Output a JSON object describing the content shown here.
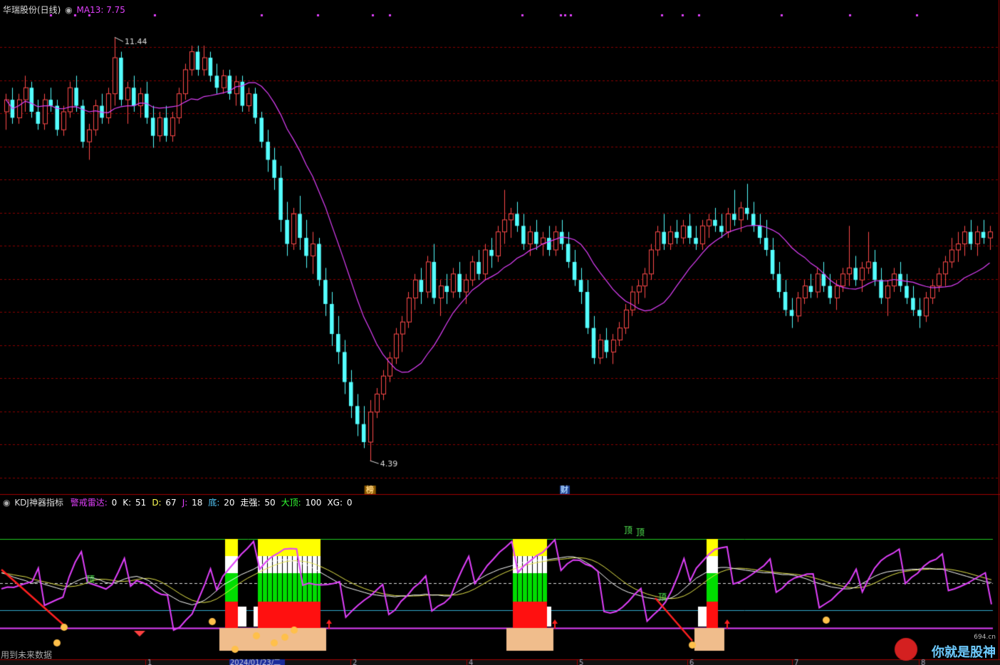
{
  "main_header": {
    "stock": "华瑞股份(日线)",
    "ma_label": "MA13: 7.75"
  },
  "high_label": "11.44",
  "low_label": "4.39",
  "event_marks": [
    "榜",
    "财"
  ],
  "ind_header": {
    "name": "KDJ神器指标",
    "items": [
      {
        "label": "警戒雷达:",
        "value": "0",
        "color": "#e040fb"
      },
      {
        "label": "K:",
        "value": "51",
        "color": "#ffffff"
      },
      {
        "label": "D:",
        "value": "67",
        "color": "#ffff55"
      },
      {
        "label": "J:",
        "value": "18",
        "color": "#e040fb"
      },
      {
        "label": "底:",
        "value": "20",
        "color": "#55ccff"
      },
      {
        "label": "走强:",
        "value": "50",
        "color": "#ffffff"
      },
      {
        "label": "大顶:",
        "value": "100",
        "color": "#33ff33"
      },
      {
        "label": "XG:",
        "value": "0",
        "color": "#ffffff"
      }
    ]
  },
  "annotations": [
    "顶",
    "顶",
    "顶",
    "顶"
  ],
  "future_note": "用到未来数据",
  "date_label": "2024/01/23/二",
  "watermark": {
    "text": "你就是股神",
    "site": "694.cn"
  },
  "colors": {
    "up": "#ff4a4a",
    "down": "#54ffff",
    "ma": "#e040fb",
    "grid": "#8b0000"
  },
  "chart_data": {
    "type": "candlestick",
    "price_range": [
      4.39,
      11.44
    ],
    "ma_period": 13,
    "candles_ohlc": [
      [
        10.2,
        10.5,
        9.9,
        10.4
      ],
      [
        10.4,
        10.6,
        10.0,
        10.1
      ],
      [
        10.1,
        10.5,
        10.0,
        10.4
      ],
      [
        10.4,
        10.8,
        10.2,
        10.6
      ],
      [
        10.6,
        10.7,
        10.1,
        10.2
      ],
      [
        10.2,
        10.4,
        9.9,
        10.0
      ],
      [
        10.0,
        10.5,
        9.9,
        10.4
      ],
      [
        10.4,
        10.6,
        10.2,
        10.3
      ],
      [
        10.3,
        10.4,
        9.8,
        9.9
      ],
      [
        9.9,
        10.3,
        9.8,
        10.2
      ],
      [
        10.2,
        10.7,
        10.1,
        10.6
      ],
      [
        10.6,
        10.8,
        10.2,
        10.3
      ],
      [
        10.3,
        10.4,
        9.6,
        9.7
      ],
      [
        9.7,
        10.0,
        9.4,
        9.9
      ],
      [
        9.9,
        10.4,
        9.8,
        10.3
      ],
      [
        10.3,
        10.5,
        10.0,
        10.1
      ],
      [
        10.1,
        10.6,
        10.0,
        10.5
      ],
      [
        10.5,
        11.44,
        10.3,
        11.1
      ],
      [
        11.1,
        11.2,
        10.3,
        10.4
      ],
      [
        10.4,
        10.7,
        10.0,
        10.6
      ],
      [
        10.6,
        10.8,
        10.2,
        10.3
      ],
      [
        10.3,
        10.6,
        10.1,
        10.5
      ],
      [
        10.5,
        10.7,
        10.0,
        10.1
      ],
      [
        10.1,
        10.3,
        9.6,
        9.8
      ],
      [
        9.8,
        10.2,
        9.7,
        10.1
      ],
      [
        10.1,
        10.3,
        9.7,
        9.8
      ],
      [
        9.8,
        10.2,
        9.7,
        10.1
      ],
      [
        10.1,
        10.6,
        10.0,
        10.5
      ],
      [
        10.5,
        11.0,
        10.4,
        10.9
      ],
      [
        10.9,
        11.3,
        10.8,
        11.2
      ],
      [
        11.2,
        11.3,
        10.8,
        10.9
      ],
      [
        10.9,
        11.3,
        10.8,
        11.1
      ],
      [
        11.1,
        11.2,
        10.7,
        10.8
      ],
      [
        10.8,
        11.0,
        10.5,
        10.6
      ],
      [
        10.6,
        10.9,
        10.5,
        10.8
      ],
      [
        10.8,
        10.9,
        10.4,
        10.5
      ],
      [
        10.5,
        10.8,
        10.3,
        10.7
      ],
      [
        10.7,
        10.8,
        10.2,
        10.3
      ],
      [
        10.3,
        10.6,
        10.2,
        10.5
      ],
      [
        10.5,
        10.6,
        10.0,
        10.1
      ],
      [
        10.1,
        10.2,
        9.6,
        9.7
      ],
      [
        9.7,
        9.9,
        9.2,
        9.4
      ],
      [
        9.4,
        9.6,
        8.9,
        9.1
      ],
      [
        9.1,
        9.3,
        8.2,
        8.4
      ],
      [
        8.4,
        8.7,
        7.8,
        8.0
      ],
      [
        8.0,
        8.6,
        7.9,
        8.5
      ],
      [
        8.5,
        8.8,
        7.9,
        8.1
      ],
      [
        8.1,
        8.4,
        7.6,
        7.8
      ],
      [
        7.8,
        8.2,
        7.5,
        8.0
      ],
      [
        8.0,
        8.1,
        7.3,
        7.4
      ],
      [
        7.4,
        7.6,
        6.8,
        7.0
      ],
      [
        7.0,
        7.2,
        6.3,
        6.5
      ],
      [
        6.5,
        6.8,
        6.0,
        6.2
      ],
      [
        6.2,
        6.4,
        5.5,
        5.7
      ],
      [
        5.7,
        5.9,
        5.1,
        5.3
      ],
      [
        5.3,
        5.5,
        4.8,
        5.0
      ],
      [
        5.0,
        5.3,
        4.6,
        4.7
      ],
      [
        4.7,
        5.4,
        4.39,
        5.2
      ],
      [
        5.2,
        5.6,
        5.1,
        5.5
      ],
      [
        5.5,
        5.9,
        5.4,
        5.8
      ],
      [
        5.8,
        6.2,
        5.7,
        6.1
      ],
      [
        6.1,
        6.6,
        6.0,
        6.5
      ],
      [
        6.5,
        6.8,
        6.2,
        6.7
      ],
      [
        6.7,
        7.2,
        6.6,
        7.1
      ],
      [
        7.1,
        7.5,
        6.9,
        7.4
      ],
      [
        7.4,
        7.6,
        7.0,
        7.2
      ],
      [
        7.2,
        7.8,
        7.1,
        7.7
      ],
      [
        7.7,
        8.0,
        7.0,
        7.1
      ],
      [
        7.1,
        7.4,
        6.8,
        7.3
      ],
      [
        7.3,
        7.5,
        7.0,
        7.2
      ],
      [
        7.2,
        7.6,
        7.1,
        7.5
      ],
      [
        7.5,
        7.7,
        7.1,
        7.2
      ],
      [
        7.2,
        7.5,
        7.0,
        7.4
      ],
      [
        7.4,
        7.8,
        7.3,
        7.7
      ],
      [
        7.7,
        7.9,
        7.4,
        7.5
      ],
      [
        7.5,
        8.0,
        7.4,
        7.9
      ],
      [
        7.9,
        8.1,
        7.6,
        7.8
      ],
      [
        7.8,
        8.3,
        7.7,
        8.2
      ],
      [
        8.2,
        8.9,
        8.0,
        8.4
      ],
      [
        8.4,
        8.6,
        8.1,
        8.5
      ],
      [
        8.5,
        8.7,
        8.2,
        8.3
      ],
      [
        8.3,
        8.5,
        7.9,
        8.0
      ],
      [
        8.0,
        8.3,
        7.8,
        8.2
      ],
      [
        8.2,
        8.4,
        7.9,
        8.0
      ],
      [
        8.0,
        8.2,
        7.8,
        8.1
      ],
      [
        8.1,
        8.3,
        7.8,
        7.9
      ],
      [
        7.9,
        8.3,
        7.8,
        8.2
      ],
      [
        8.2,
        8.4,
        7.9,
        8.0
      ],
      [
        8.0,
        8.2,
        7.6,
        7.7
      ],
      [
        7.7,
        7.9,
        7.3,
        7.4
      ],
      [
        7.4,
        7.6,
        7.0,
        7.2
      ],
      [
        7.2,
        7.4,
        6.5,
        6.6
      ],
      [
        6.6,
        6.8,
        6.0,
        6.1
      ],
      [
        6.1,
        6.5,
        6.0,
        6.4
      ],
      [
        6.4,
        6.6,
        6.1,
        6.2
      ],
      [
        6.2,
        6.5,
        6.0,
        6.4
      ],
      [
        6.4,
        6.7,
        6.3,
        6.6
      ],
      [
        6.6,
        7.0,
        6.5,
        6.9
      ],
      [
        6.9,
        7.3,
        6.8,
        7.2
      ],
      [
        7.2,
        7.4,
        7.0,
        7.3
      ],
      [
        7.3,
        7.6,
        7.1,
        7.5
      ],
      [
        7.5,
        8.0,
        7.4,
        7.9
      ],
      [
        7.9,
        8.3,
        7.8,
        8.2
      ],
      [
        8.2,
        8.5,
        7.9,
        8.0
      ],
      [
        8.0,
        8.3,
        7.9,
        8.2
      ],
      [
        8.2,
        8.4,
        8.0,
        8.1
      ],
      [
        8.1,
        8.4,
        8.0,
        8.3
      ],
      [
        8.3,
        8.5,
        8.0,
        8.1
      ],
      [
        8.1,
        8.3,
        7.9,
        8.0
      ],
      [
        8.0,
        8.4,
        7.9,
        8.3
      ],
      [
        8.3,
        8.5,
        8.1,
        8.4
      ],
      [
        8.4,
        8.6,
        8.2,
        8.3
      ],
      [
        8.3,
        8.5,
        8.1,
        8.2
      ],
      [
        8.2,
        8.6,
        8.1,
        8.5
      ],
      [
        8.5,
        8.9,
        8.3,
        8.4
      ],
      [
        8.4,
        8.7,
        8.2,
        8.6
      ],
      [
        8.6,
        9.0,
        8.4,
        8.5
      ],
      [
        8.5,
        8.7,
        8.2,
        8.3
      ],
      [
        8.3,
        8.5,
        8.0,
        8.1
      ],
      [
        8.1,
        8.4,
        7.8,
        7.9
      ],
      [
        7.9,
        8.1,
        7.4,
        7.5
      ],
      [
        7.5,
        7.7,
        7.1,
        7.2
      ],
      [
        7.2,
        7.4,
        6.8,
        6.9
      ],
      [
        6.9,
        7.1,
        6.6,
        6.8
      ],
      [
        6.8,
        7.2,
        6.7,
        7.1
      ],
      [
        7.1,
        7.4,
        7.0,
        7.3
      ],
      [
        7.3,
        7.5,
        7.1,
        7.2
      ],
      [
        7.2,
        7.6,
        7.1,
        7.5
      ],
      [
        7.5,
        7.7,
        7.2,
        7.3
      ],
      [
        7.3,
        7.5,
        7.0,
        7.1
      ],
      [
        7.1,
        7.4,
        6.9,
        7.3
      ],
      [
        7.3,
        7.6,
        7.2,
        7.5
      ],
      [
        7.5,
        8.3,
        7.3,
        7.6
      ],
      [
        7.6,
        7.8,
        7.3,
        7.4
      ],
      [
        7.4,
        7.7,
        7.2,
        7.6
      ],
      [
        7.6,
        8.2,
        7.5,
        7.7
      ],
      [
        7.7,
        7.9,
        7.3,
        7.4
      ],
      [
        7.4,
        7.6,
        7.0,
        7.1
      ],
      [
        7.1,
        7.4,
        6.8,
        7.3
      ],
      [
        7.3,
        7.6,
        7.2,
        7.5
      ],
      [
        7.5,
        7.7,
        7.2,
        7.3
      ],
      [
        7.3,
        7.5,
        7.0,
        7.1
      ],
      [
        7.1,
        7.3,
        6.8,
        6.9
      ],
      [
        6.9,
        7.1,
        6.6,
        6.8
      ],
      [
        6.8,
        7.2,
        6.7,
        7.1
      ],
      [
        7.1,
        7.4,
        7.0,
        7.3
      ],
      [
        7.3,
        7.6,
        7.2,
        7.5
      ],
      [
        7.5,
        7.8,
        7.3,
        7.7
      ],
      [
        7.7,
        8.1,
        7.6,
        7.9
      ],
      [
        7.9,
        8.2,
        7.7,
        8.0
      ],
      [
        8.0,
        8.3,
        7.8,
        8.2
      ],
      [
        8.2,
        8.4,
        7.9,
        8.0
      ],
      [
        8.0,
        8.3,
        7.8,
        8.2
      ],
      [
        8.2,
        8.4,
        8.0,
        8.1
      ],
      [
        8.1,
        8.3,
        7.9,
        8.2
      ]
    ],
    "kdj": {
      "K": [
        62,
        60,
        57,
        55,
        53,
        50,
        52,
        49,
        47,
        45,
        43,
        48,
        52,
        55,
        57,
        56,
        54,
        51,
        50,
        52,
        55,
        57,
        58,
        56,
        53,
        48,
        43,
        38,
        34,
        30,
        28,
        26,
        28,
        31,
        36,
        42,
        48,
        52,
        56,
        60,
        63,
        66,
        70,
        73,
        75,
        76,
        77,
        76,
        74,
        72,
        70,
        66,
        62,
        58,
        54,
        50,
        46,
        44,
        42,
        40,
        38,
        37,
        36,
        36,
        35,
        36,
        36,
        37,
        37,
        38,
        37,
        37,
        36,
        36,
        40,
        44,
        48,
        52,
        56,
        60,
        63,
        66,
        68,
        70,
        72,
        74,
        75,
        76,
        76,
        77,
        78,
        79,
        80,
        80,
        78,
        74,
        70,
        64,
        58,
        52,
        47,
        43,
        40,
        38,
        36,
        34,
        33,
        32,
        32,
        34,
        38,
        44,
        50,
        56,
        60,
        64,
        67,
        68,
        68,
        67,
        66,
        65,
        64,
        63,
        62,
        62,
        61,
        60,
        60,
        59,
        57,
        55,
        52,
        50,
        48,
        46,
        45,
        44,
        44,
        46,
        50,
        54,
        58,
        61,
        63,
        64,
        65,
        65,
        66,
        66,
        67,
        67,
        66,
        66,
        64,
        62,
        60,
        58,
        56,
        54,
        52,
        51
      ]
    }
  }
}
